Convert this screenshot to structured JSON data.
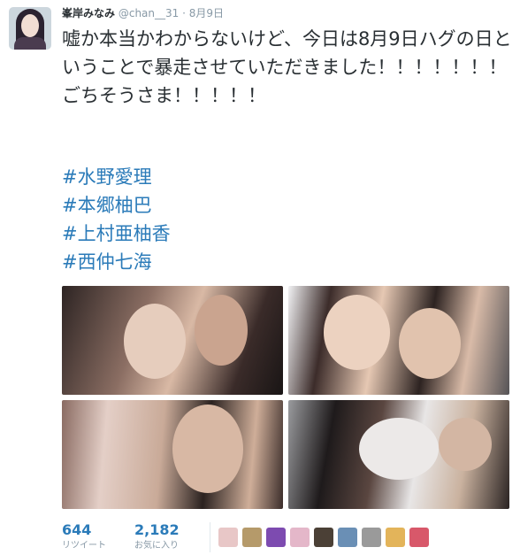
{
  "tweet": {
    "display_name": "峯岸みなみ",
    "handle": "@chan__31",
    "separator": "·",
    "date": "8月9日",
    "text": "嘘か本当かわからないけど、今日は8月9日ハグの日ということで暴走させていただきました！！！！！！！ごちそうさま！！！！！",
    "hashtags": [
      "#水野愛理",
      "#本郷柚巴",
      "#上村亜柚香",
      "#西仲七海"
    ]
  },
  "stats": {
    "retweets": {
      "count": "644",
      "label": "リツイート"
    },
    "favorites": {
      "count": "2,182",
      "label": "お気に入り"
    }
  },
  "favoriters": [
    {
      "name": "favoriter-avatar-1",
      "color": "#e8c7c7"
    },
    {
      "name": "favoriter-avatar-2",
      "color": "#b59a6a"
    },
    {
      "name": "favoriter-avatar-3",
      "color": "#7d4bb0"
    },
    {
      "name": "favoriter-avatar-4",
      "color": "#e4b7c9"
    },
    {
      "name": "favoriter-avatar-5",
      "color": "#4b4036"
    },
    {
      "name": "favoriter-avatar-6",
      "color": "#6a8fb5"
    },
    {
      "name": "favoriter-avatar-7",
      "color": "#9a9a9a"
    },
    {
      "name": "favoriter-avatar-8",
      "color": "#e3b45a"
    },
    {
      "name": "favoriter-avatar-9",
      "color": "#d8586a"
    }
  ]
}
